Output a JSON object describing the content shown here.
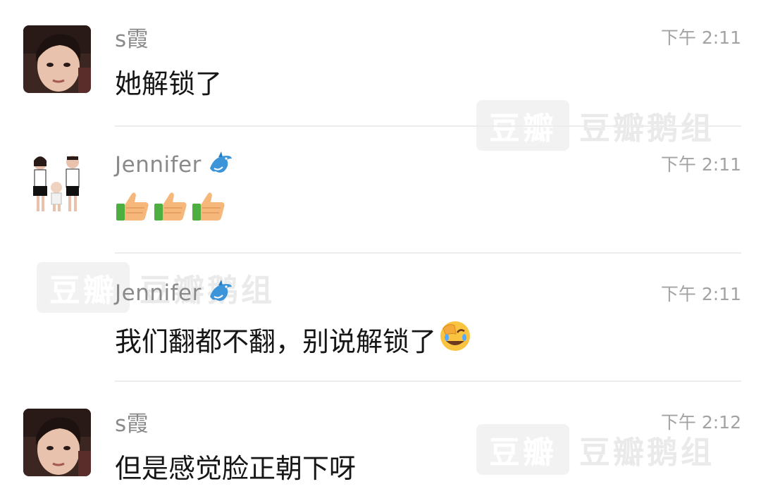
{
  "messages": [
    {
      "sender": "s霞",
      "time": "下午 2:11",
      "text": "她解锁了",
      "avatar": "woman-photo",
      "badge": null
    },
    {
      "sender": "Jennifer",
      "time": "下午 2:11",
      "text": "",
      "avatar": "family-cartoon",
      "badge": "dolphin-icon",
      "emojis": [
        "thumbs-up-icon",
        "thumbs-up-icon",
        "thumbs-up-icon"
      ]
    },
    {
      "sender": "Jennifer",
      "time": "下午 2:11",
      "text": "我们翻都不翻，别说解锁了",
      "avatar": null,
      "badge": "dolphin-icon",
      "trailing_emoji": "face-palm-laugh-icon"
    },
    {
      "sender": "s霞",
      "time": "下午 2:12",
      "text": "但是感觉脸正朝下呀",
      "avatar": "woman-photo",
      "badge": null
    }
  ],
  "watermarks": [
    {
      "box": "豆瓣",
      "text": "豆瓣鹅组"
    },
    {
      "box": "豆瓣",
      "text": "豆瓣鹅组"
    },
    {
      "box": "豆瓣",
      "text": "豆瓣鹅组"
    }
  ],
  "colors": {
    "name": "#8a8a8a",
    "time": "#a3a3a3",
    "body": "#161616",
    "divider": "#ececec"
  }
}
